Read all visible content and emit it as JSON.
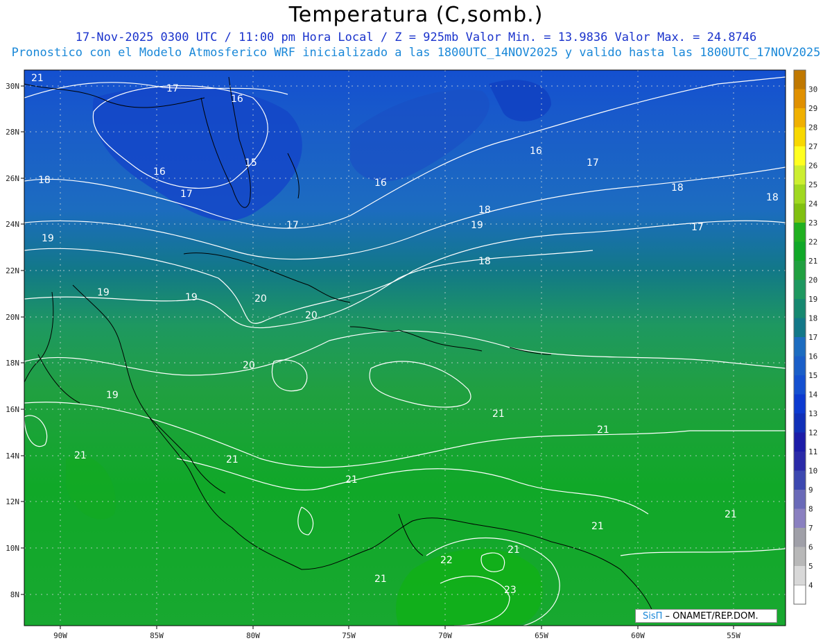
{
  "title": "Temperatura (C,somb.)",
  "subtitle1": "17-Nov-2025 0300 UTC / 11:00 pm Hora Local / Z = 925mb   Valor Min. = 13.9836  Valor Max. = 24.8746",
  "subtitle2": "Pronostico con el Modelo Atmosferico WRF inicializado a las 1800UTC_14NOV2025 y valido hasta las  1800UTC_17NOV2025",
  "credit": {
    "brand": "SisΠ",
    "text": " – ONAMET/REP.DOM."
  },
  "axes": {
    "lon_labels": [
      "90W",
      "85W",
      "80W",
      "75W",
      "70W",
      "65W",
      "60W",
      "55W"
    ],
    "lat_labels": [
      "30N",
      "28N",
      "26N",
      "24N",
      "22N",
      "20N",
      "18N",
      "16N",
      "14N",
      "12N",
      "10N",
      "8N"
    ]
  },
  "colorbar": {
    "values": [
      30,
      29,
      28,
      27,
      26,
      25,
      24,
      23,
      22,
      21,
      20,
      19,
      18,
      17,
      16,
      15,
      14,
      13,
      12,
      11,
      10,
      9,
      8,
      7,
      6,
      5,
      4
    ],
    "colors": [
      "#c07800",
      "#e09000",
      "#f0b000",
      "#f8d800",
      "#ffff20",
      "#ccee30",
      "#a0d820",
      "#80c010",
      "#20b020",
      "#10a828",
      "#20a040",
      "#1e9860",
      "#168870",
      "#127888",
      "#1c6cc0",
      "#1a5ec8",
      "#1450d0",
      "#0c3ad0",
      "#1030b8",
      "#1c1ca8",
      "#2a2aa8",
      "#3c48b0",
      "#6a6ab8",
      "#8a80c0",
      "#a0a0a8",
      "#b8b8b8",
      "#d8d8d8"
    ],
    "bottom_color": "#ffffff"
  },
  "contour_labels": [
    "17",
    "16",
    "16",
    "15",
    "16",
    "17",
    "17",
    "16",
    "17",
    "18",
    "18",
    "18",
    "18",
    "17",
    "19",
    "19",
    "19",
    "20",
    "20",
    "18",
    "19",
    "19",
    "20",
    "21",
    "21",
    "21",
    "21",
    "21",
    "21",
    "21",
    "21",
    "22",
    "21",
    "23",
    "21"
  ],
  "title_note": ""
}
